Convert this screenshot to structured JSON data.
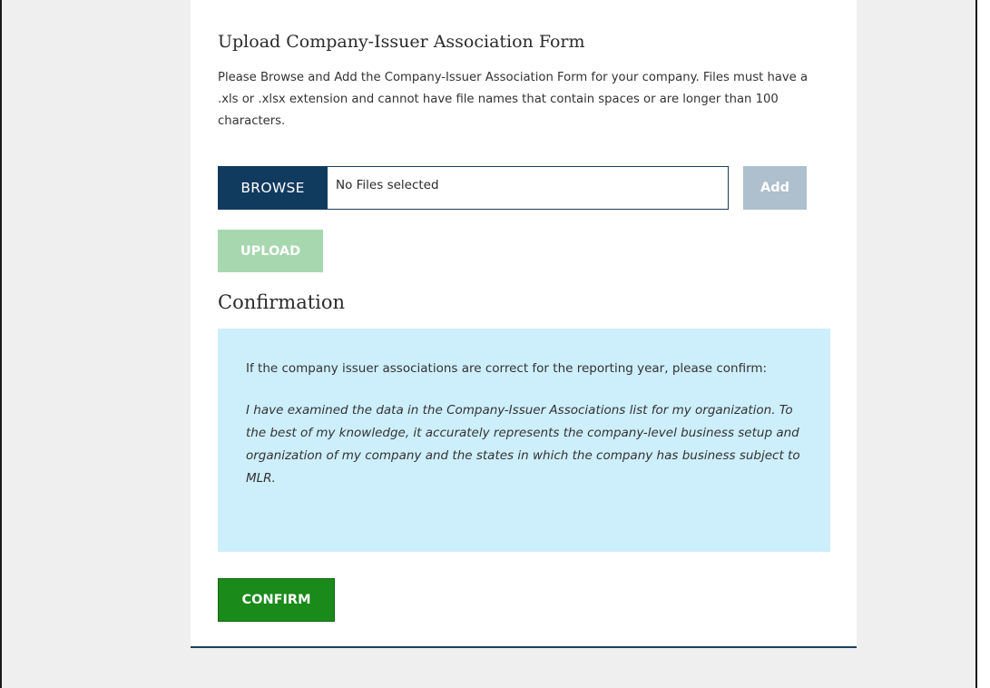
{
  "upload": {
    "title": "Upload Company-Issuer Association Form",
    "instructions": "Please Browse and Add the Company-Issuer Association Form for your company. Files must have a .xls or .xlsx extension and cannot have file names that contain spaces or are longer than 100 characters.",
    "browse_label": "BROWSE",
    "file_status": "No Files selected",
    "add_label": "Add",
    "upload_label": "UPLOAD"
  },
  "confirmation": {
    "title": "Confirmation",
    "prompt": "If the company issuer associations are correct for the reporting year, please confirm:",
    "statement": "I have examined the data in the Company-Issuer Associations list for my organization. To the best of my knowledge, it accurately represents the company-level business setup and organization of my company and the states in which the company has business subject to MLR.",
    "confirm_label": "CONFIRM"
  },
  "colors": {
    "browse_button": "#113a5f",
    "add_button_disabled": "#aebfcd",
    "upload_button_disabled": "#a6d7ae",
    "info_box": "#cdeefb",
    "confirm_button": "#1a8a1a"
  }
}
